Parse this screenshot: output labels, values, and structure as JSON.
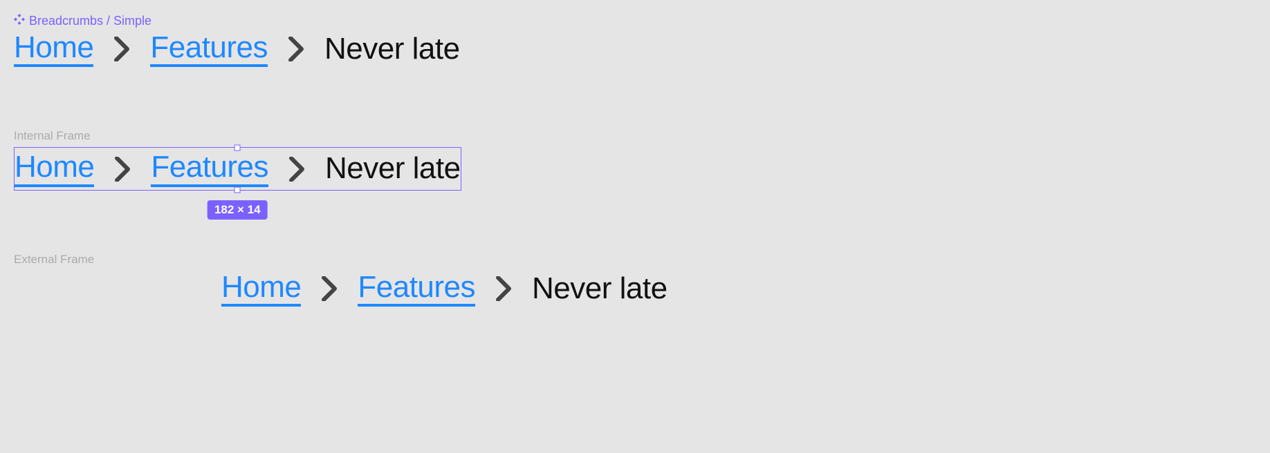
{
  "component": {
    "name": "Breadcrumbs / Simple"
  },
  "frames": {
    "internal_label": "Internal Frame",
    "external_label": "External Frame"
  },
  "breadcrumb": {
    "items": [
      {
        "label": "Home",
        "link": true
      },
      {
        "label": "Features",
        "link": true
      },
      {
        "label": "Never late",
        "link": false
      }
    ]
  },
  "selection": {
    "size_label": "182 × 14"
  },
  "colors": {
    "accent": "#7b61ff",
    "link": "#1e88ff",
    "text": "#111",
    "muted": "#aaa",
    "bg": "#e5e5e5"
  }
}
